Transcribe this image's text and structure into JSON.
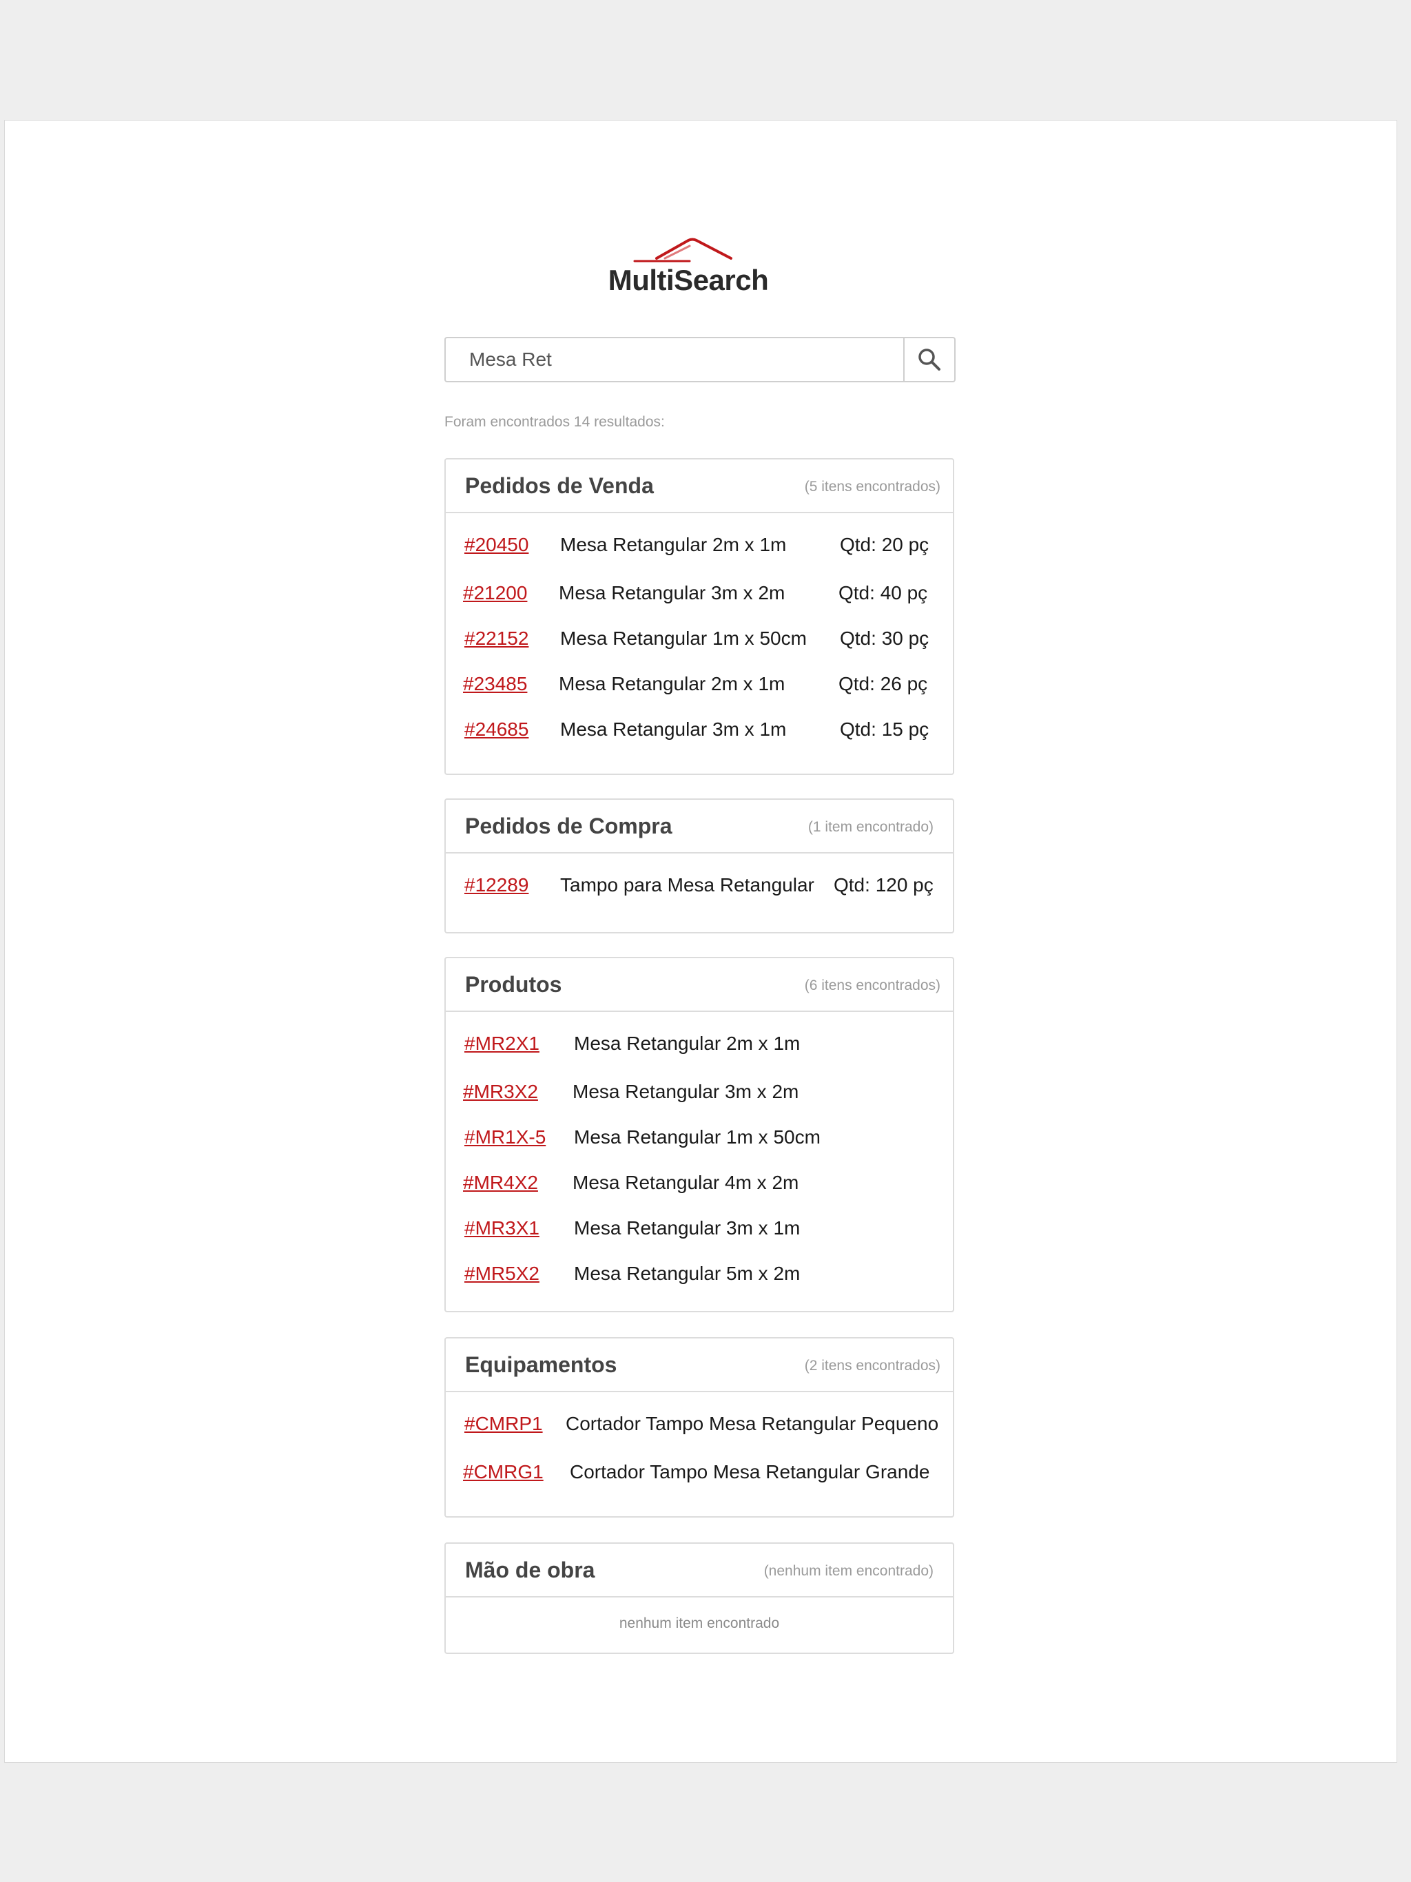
{
  "brand": {
    "name": "MultiSearch",
    "accent": "#c0181b"
  },
  "search": {
    "value": "Mesa Ret",
    "button_icon": "search-icon"
  },
  "summary": "Foram encontrados 14 resultados:",
  "sections": {
    "venda": {
      "title": "Pedidos de Venda",
      "count": "(5 itens encontrados)",
      "items": [
        {
          "code": "#20450",
          "desc": "Mesa Retangular 2m x 1m",
          "qty": "Qtd: 20 pç"
        },
        {
          "code": "#21200",
          "desc": "Mesa Retangular 3m x 2m",
          "qty": "Qtd: 40 pç"
        },
        {
          "code": "#22152",
          "desc": "Mesa Retangular 1m x 50cm",
          "qty": "Qtd: 30 pç"
        },
        {
          "code": "#23485",
          "desc": "Mesa Retangular 2m x 1m",
          "qty": "Qtd: 26 pç"
        },
        {
          "code": "#24685",
          "desc": "Mesa Retangular 3m x 1m",
          "qty": "Qtd: 15 pç"
        }
      ]
    },
    "compra": {
      "title": "Pedidos de Compra",
      "count": "(1 item encontrado)",
      "items": [
        {
          "code": "#12289",
          "desc": "Tampo para Mesa Retangular",
          "qty": "Qtd: 120 pç"
        }
      ]
    },
    "produtos": {
      "title": "Produtos",
      "count": "(6 itens encontrados)",
      "items": [
        {
          "code": "#MR2X1",
          "desc": "Mesa Retangular 2m x 1m"
        },
        {
          "code": "#MR3X2",
          "desc": "Mesa Retangular 3m x 2m"
        },
        {
          "code": "#MR1X-5",
          "desc": "Mesa Retangular 1m x 50cm"
        },
        {
          "code": "#MR4X2",
          "desc": "Mesa Retangular 4m x 2m"
        },
        {
          "code": "#MR3X1",
          "desc": "Mesa Retangular 3m x 1m"
        },
        {
          "code": "#MR5X2",
          "desc": "Mesa Retangular 5m x 2m"
        }
      ]
    },
    "equipamentos": {
      "title": "Equipamentos",
      "count": "(2 itens encontrados)",
      "items": [
        {
          "code": "#CMRP1",
          "desc": "Cortador Tampo Mesa Retangular Pequeno"
        },
        {
          "code": "#CMRG1",
          "desc": "Cortador Tampo Mesa Retangular Grande"
        }
      ]
    },
    "mao_de_obra": {
      "title": "Mão de obra",
      "count": "(nenhum item encontrado)",
      "empty": "nenhum item encontrado"
    }
  }
}
